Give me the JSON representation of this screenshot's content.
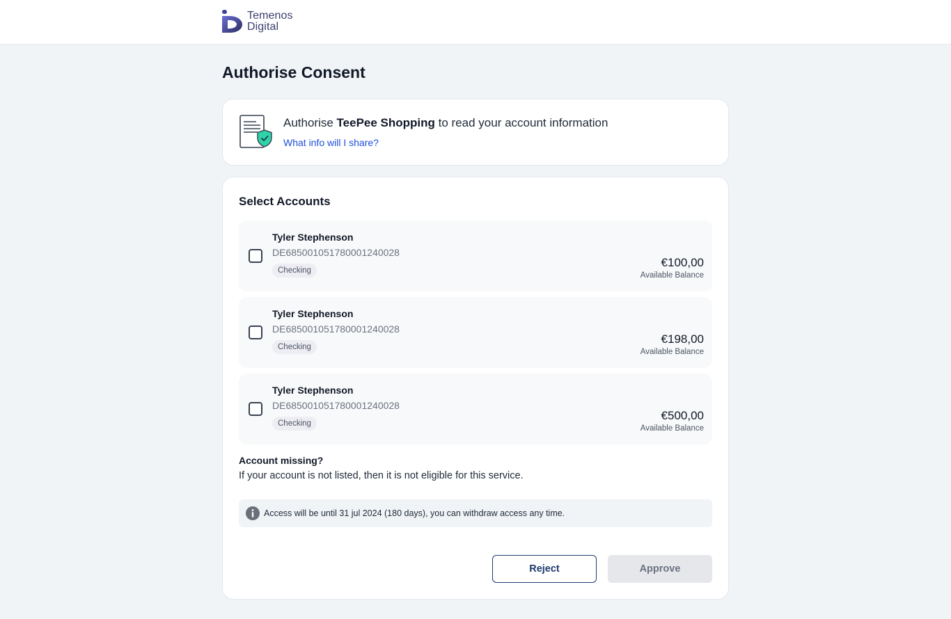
{
  "brand": {
    "logo_line1": "Temenos",
    "logo_line2": "Digital",
    "colors": {
      "primary": "#1e3a6e",
      "link": "#1d4ed8",
      "shield": "#2dd4a7"
    }
  },
  "page": {
    "title": "Authorise Consent"
  },
  "consent": {
    "prefix": "Authorise ",
    "tpp_name": "TeePee Shopping",
    "suffix": " to read your account information",
    "info_link": "What info will I share?",
    "icon": "document-shield-icon"
  },
  "accounts": {
    "title": "Select Accounts",
    "balance_label": "Available Balance",
    "items": [
      {
        "name": "Tyler Stephenson",
        "iban": "DE68500105178000124002​8",
        "type": "Checking",
        "balance": "€100,00",
        "selected": false
      },
      {
        "name": "Tyler Stephenson",
        "iban": "DE685001051780001240028",
        "type": "Checking",
        "balance": "€198,00",
        "selected": false
      },
      {
        "name": "Tyler Stephenson",
        "iban": "DE685001051780001240028",
        "type": "Checking",
        "balance": "€500,00",
        "selected": false
      }
    ]
  },
  "missing": {
    "title": "Account missing?",
    "text": "If your account is not listed, then it is not eligible for this service."
  },
  "access_info": {
    "icon": "info-icon",
    "text": "Access will be until 31 jul 2024 (180 days), you can withdraw access any time."
  },
  "actions": {
    "reject_label": "Reject",
    "approve_label": "Approve"
  }
}
